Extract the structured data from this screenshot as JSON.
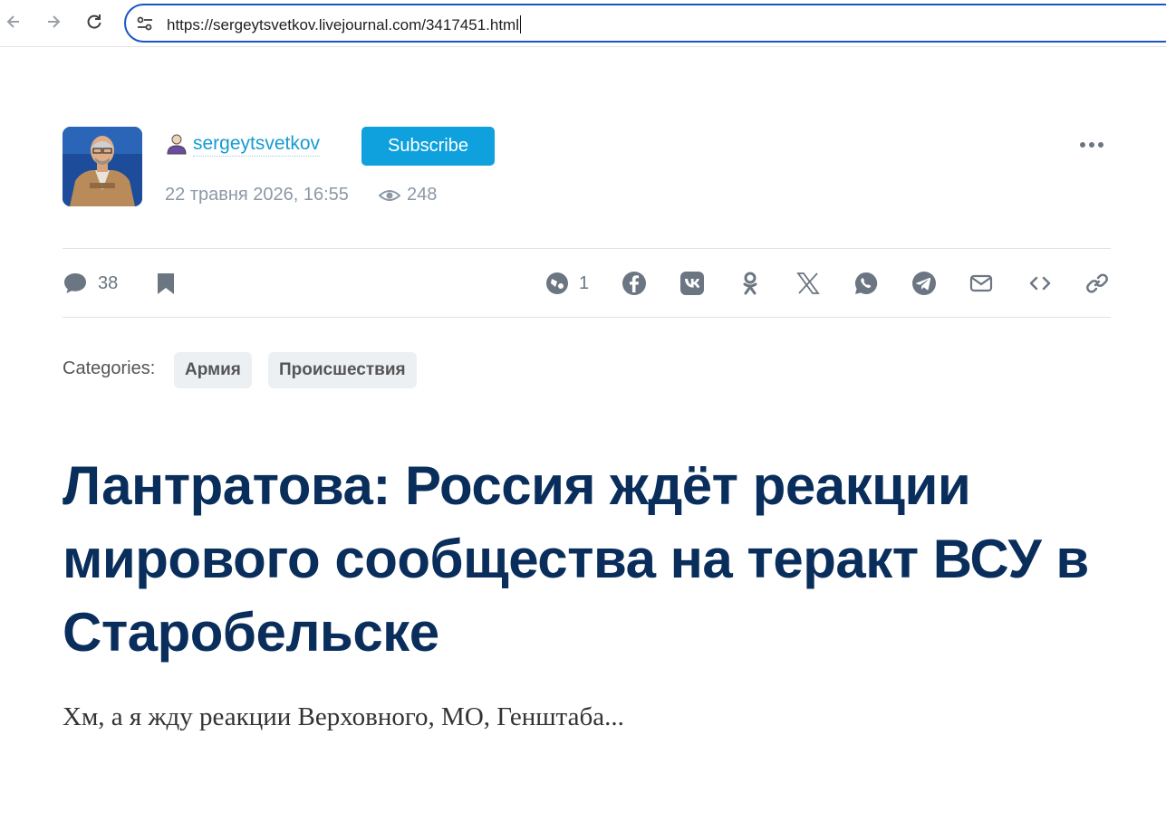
{
  "browser": {
    "url": "https://sergeytsvetkov.livejournal.com/3417451.html",
    "icons": [
      "back-icon",
      "forward-icon",
      "reload-icon",
      "site-info-icon"
    ]
  },
  "author": {
    "username": "sergeytsvetkov",
    "subscribe_label": "Subscribe",
    "date": "22 травня 2026, 16:55",
    "views": "248"
  },
  "actions": {
    "comments": "38",
    "reposts": "1",
    "icons": [
      "comment-icon",
      "bookmark-icon",
      "repost-icon",
      "facebook-icon",
      "vk-icon",
      "odnoklassniki-icon",
      "x-icon",
      "whatsapp-icon",
      "telegram-icon",
      "email-icon",
      "embed-icon",
      "link-icon"
    ]
  },
  "categories": {
    "label": "Categories:",
    "items": [
      "Армия",
      "Происшествия"
    ]
  },
  "post": {
    "title": "Лантратова: Россия ждёт реакции мирового сообщества на теракт ВСУ в Старобельске",
    "body": "Хм, а я жду реакции Верховного, МО, Генштаба..."
  },
  "colors": {
    "accent": "#0ea1dd",
    "link": "#159bd1",
    "title": "#0a2e5c",
    "address_border": "#1a56c5",
    "icon_gray": "#6b7682"
  }
}
